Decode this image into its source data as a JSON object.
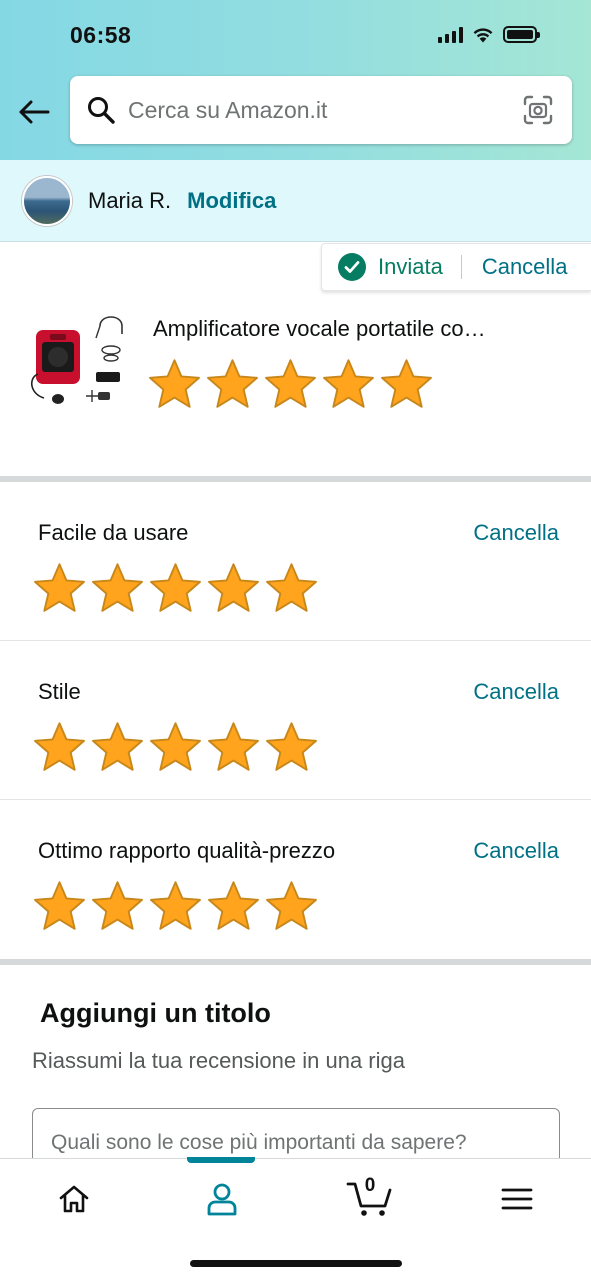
{
  "status_bar": {
    "time": "06:58"
  },
  "search": {
    "placeholder": "Cerca su Amazon.it"
  },
  "profile": {
    "name": "Maria R.",
    "edit_label": "Modifica"
  },
  "submission": {
    "status_label": "Inviata",
    "cancel_label": "Cancella"
  },
  "product": {
    "title": "Amplificatore vocale portatile co…",
    "rating": 5,
    "max_rating": 5
  },
  "ratings": [
    {
      "label": "Facile da usare",
      "cancel_label": "Cancella",
      "rating": 5
    },
    {
      "label": "Stile",
      "cancel_label": "Cancella",
      "rating": 5
    },
    {
      "label": "Ottimo rapporto qualità-prezzo",
      "cancel_label": "Cancella",
      "rating": 5
    }
  ],
  "headline": {
    "heading": "Aggiungi un titolo",
    "subtext": "Riassumi la tua recensione in una riga",
    "input_placeholder": "Quali sono le cose più importanti da sapere?",
    "input_value": ""
  },
  "nav": {
    "items": [
      "home-icon",
      "account-icon",
      "cart-icon",
      "menu-icon"
    ],
    "active": "account-icon",
    "cart_count": "0"
  },
  "colors": {
    "link": "#007185",
    "success": "#067d62",
    "star": "#ffa41c",
    "accent": "#00849a"
  }
}
